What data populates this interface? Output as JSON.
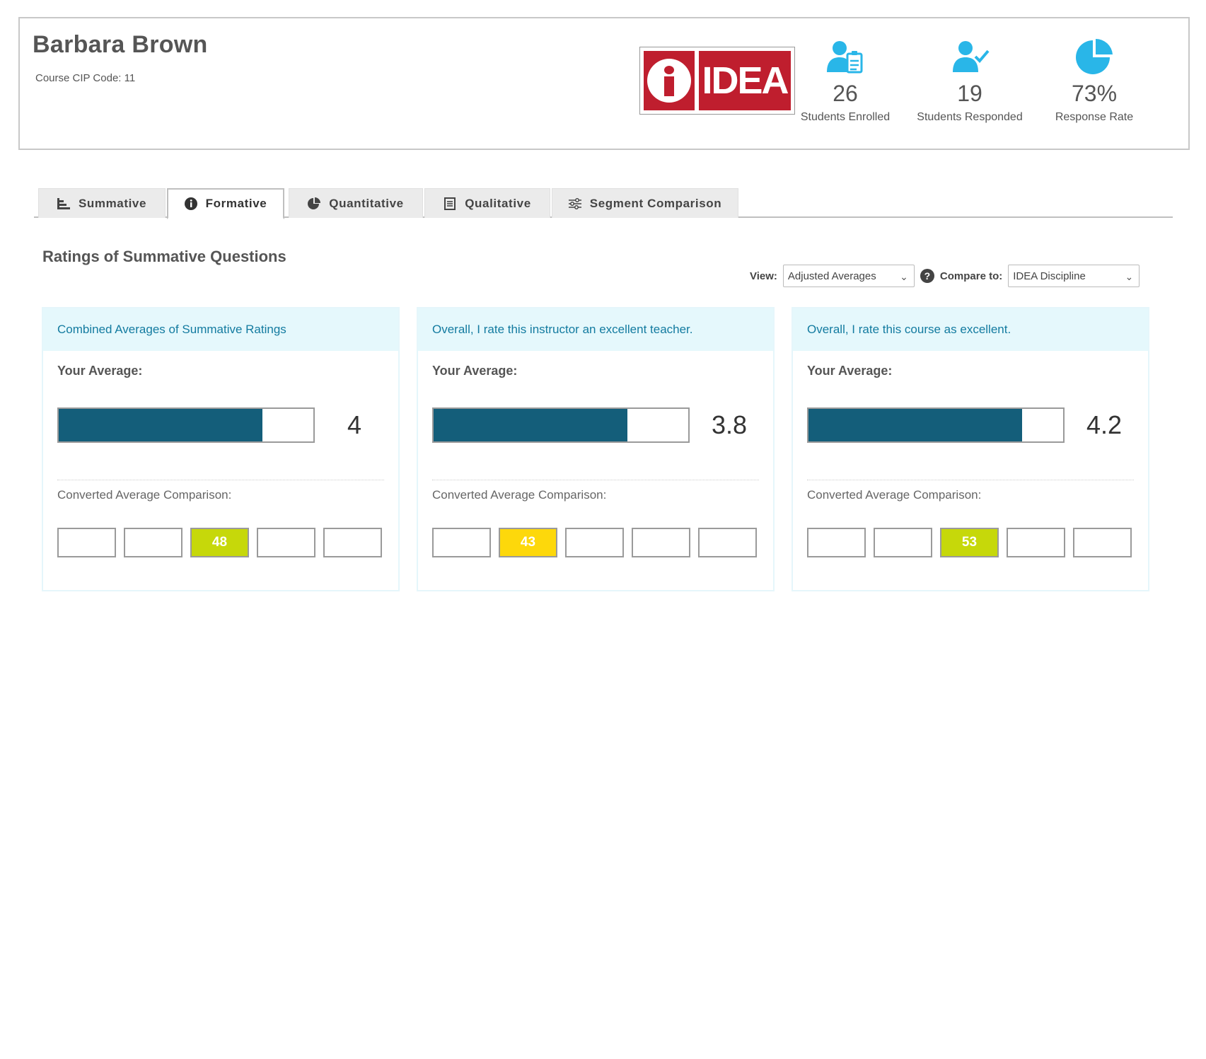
{
  "header": {
    "name": "Barbara Brown",
    "cip_code": "Course CIP Code: 11",
    "logo_text": "IDEA",
    "stats": [
      {
        "value": "26",
        "label": "Students Enrolled",
        "icon": "user-clipboard-icon"
      },
      {
        "value": "19",
        "label": "Students Responded",
        "icon": "user-check-icon"
      },
      {
        "value": "73%",
        "label": "Response Rate",
        "icon": "pie-chart-icon"
      }
    ]
  },
  "tabs": [
    {
      "label": "Summative",
      "icon": "bar-chart-icon",
      "active": false
    },
    {
      "label": "Formative",
      "icon": "info-icon",
      "active": true
    },
    {
      "label": "Quantitative",
      "icon": "pie-chart-icon",
      "active": false
    },
    {
      "label": "Qualitative",
      "icon": "document-icon",
      "active": false
    },
    {
      "label": "Segment Comparison",
      "icon": "sliders-icon",
      "active": false
    }
  ],
  "section_title": "Ratings of Summative Questions",
  "controls": {
    "view_label": "View:",
    "view_value": "Adjusted Averages",
    "compare_label": "Compare to:",
    "compare_value": "IDEA Discipline"
  },
  "colors": {
    "accent": "#29b6e8",
    "bar_fill": "#145e7a",
    "header_link": "#137ba0",
    "green_box": "#c6d80a",
    "yellow_box": "#fdd80b",
    "logo_red": "#bf1e2e"
  },
  "cards": [
    {
      "title": "Combined Averages of Summative Ratings",
      "your_average_label": "Your Average:",
      "average": "4",
      "average_value": 4.0,
      "bar_fraction": 0.8,
      "comparison_label": "Converted Average Comparison:",
      "boxes": [
        "",
        "",
        "48",
        "",
        ""
      ],
      "highlight_index": 2,
      "highlight_color": "green"
    },
    {
      "title": "Overall, I rate this instructor an excellent teacher.",
      "your_average_label": "Your Average:",
      "average": "3.8",
      "average_value": 3.8,
      "bar_fraction": 0.76,
      "comparison_label": "Converted Average Comparison:",
      "boxes": [
        "",
        "43",
        "",
        "",
        ""
      ],
      "highlight_index": 1,
      "highlight_color": "yellow"
    },
    {
      "title": "Overall, I rate this course as excellent.",
      "your_average_label": "Your Average:",
      "average": "4.2",
      "average_value": 4.2,
      "bar_fraction": 0.84,
      "comparison_label": "Converted Average Comparison:",
      "boxes": [
        "",
        "",
        "53",
        "",
        ""
      ],
      "highlight_index": 2,
      "highlight_color": "green"
    }
  ]
}
